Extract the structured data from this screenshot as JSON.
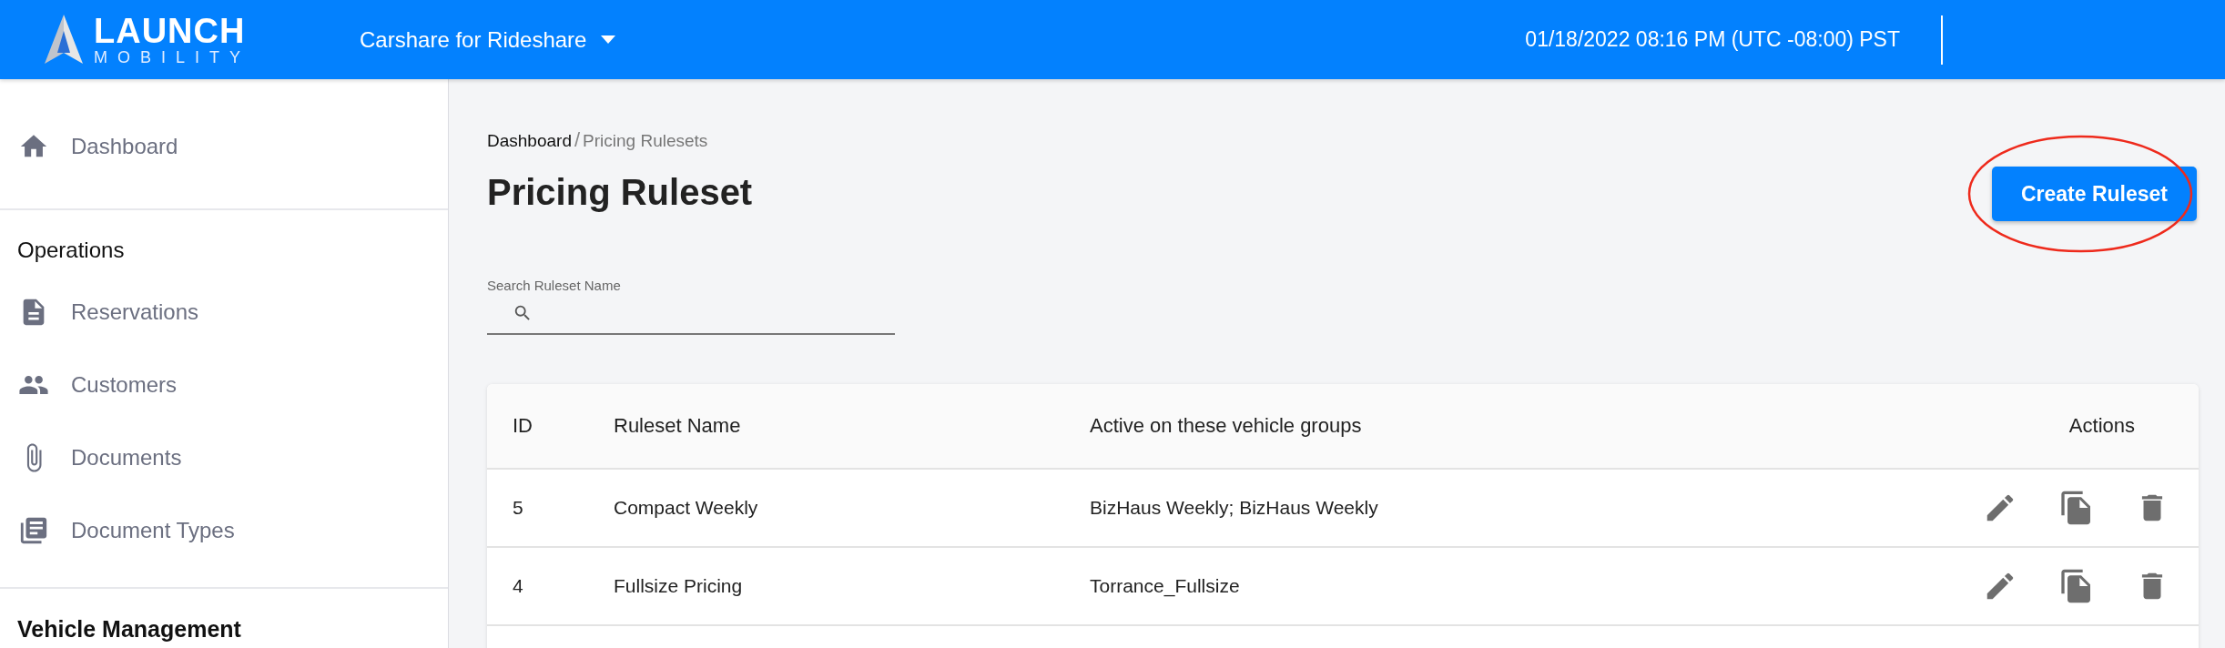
{
  "header": {
    "logo": {
      "word": "LAUNCH",
      "subword": "MOBILITY"
    },
    "workspace": "Carshare for Rideshare",
    "datetime": "01/18/2022 08:16 PM (UTC -08:00) PST"
  },
  "sidebar": {
    "sections": [
      {
        "items": [
          {
            "label": "Dashboard",
            "kind": "home"
          }
        ]
      },
      {
        "title": "Operations",
        "items": [
          {
            "label": "Reservations",
            "kind": "file"
          },
          {
            "label": "Customers",
            "kind": "people"
          },
          {
            "label": "Documents",
            "kind": "clip"
          },
          {
            "label": "Document Types",
            "kind": "library"
          }
        ]
      },
      {
        "title": "Vehicle Management"
      }
    ]
  },
  "breadcrumb": {
    "separator": "/",
    "items": [
      {
        "label": "Dashboard"
      },
      {
        "label": "Pricing Rulesets"
      }
    ]
  },
  "page_title": "Pricing Ruleset",
  "create_button": "Create Ruleset",
  "search": {
    "label": "Search Ruleset Name"
  },
  "table": {
    "columns": [
      "ID",
      "Ruleset Name",
      "Active on these vehicle groups",
      "Actions"
    ],
    "rows": [
      {
        "id": "5",
        "name": "Compact Weekly",
        "groups": "BizHaus Weekly; BizHaus Weekly"
      },
      {
        "id": "4",
        "name": "Fullsize Pricing",
        "groups": "Torrance_Fullsize"
      }
    ]
  }
}
